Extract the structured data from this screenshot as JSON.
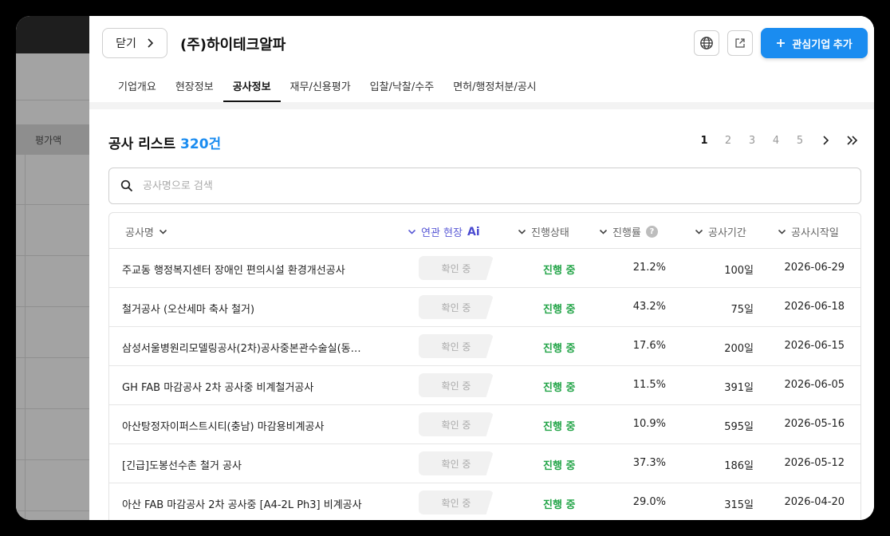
{
  "backdrop": {
    "column_header": "평가액"
  },
  "header": {
    "close_label": "닫기",
    "company_name": "(주)하이테크알파",
    "favorite_label": "관심기업 추가"
  },
  "tabs": [
    {
      "label": "기업개요"
    },
    {
      "label": "현장정보"
    },
    {
      "label": "공사정보",
      "active": true
    },
    {
      "label": "재무/신용평가"
    },
    {
      "label": "입찰/낙찰/수주"
    },
    {
      "label": "면허/행정처분/공시"
    }
  ],
  "list": {
    "title": "공사 리스트",
    "count": "320건"
  },
  "pager": {
    "pages": [
      "1",
      "2",
      "3",
      "4",
      "5"
    ],
    "current": "1"
  },
  "search": {
    "placeholder": "공사명으로 검색"
  },
  "table": {
    "columns": {
      "name": "공사명",
      "related": "연관 현장",
      "ai": "Ai",
      "status": "진행상태",
      "rate": "진행률",
      "help": "?",
      "period": "공사기간",
      "start": "공사시작일"
    },
    "rows": [
      {
        "name": "주교동 행정복지센터 장애인 편의시설 환경개선공사",
        "related": "확인 중",
        "status": "진행 중",
        "rate": "21.2%",
        "period": "100일",
        "start": "2026-06-29"
      },
      {
        "name": "철거공사 (오산세마 축사 철거)",
        "related": "확인 중",
        "status": "진행 중",
        "rate": "43.2%",
        "period": "75일",
        "start": "2026-06-18"
      },
      {
        "name": "삼성서울병원리모델링공사(2차)공사중본관수술실(동…",
        "related": "확인 중",
        "status": "진행 중",
        "rate": "17.6%",
        "period": "200일",
        "start": "2026-06-15"
      },
      {
        "name": "GH FAB 마감공사 2차 공사중 비계철거공사",
        "related": "확인 중",
        "status": "진행 중",
        "rate": "11.5%",
        "period": "391일",
        "start": "2026-06-05"
      },
      {
        "name": "아산탕정자이퍼스트시티(충남) 마감용비계공사",
        "related": "확인 중",
        "status": "진행 중",
        "rate": "10.9%",
        "period": "595일",
        "start": "2026-05-16"
      },
      {
        "name": "[긴급]도봉선수촌 철거 공사",
        "related": "확인 중",
        "status": "진행 중",
        "rate": "37.3%",
        "period": "186일",
        "start": "2026-05-12"
      },
      {
        "name": "아산 FAB 마감공사 2차 공사중 [A4-2L Ph3] 비계공사",
        "related": "확인 중",
        "status": "진행 중",
        "rate": "29.0%",
        "period": "315일",
        "start": "2026-04-20"
      }
    ]
  },
  "colors": {
    "accent": "#1a8cf0",
    "status": "#22a447",
    "ai": "#5b5bd6"
  }
}
